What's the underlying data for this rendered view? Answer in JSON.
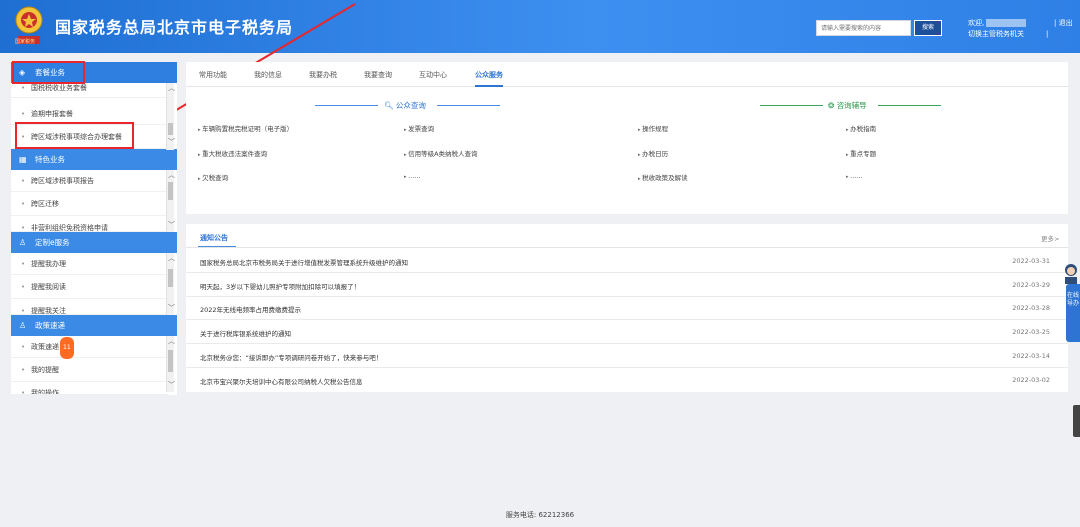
{
  "header": {
    "emblem_caption": "国家税务",
    "title": "国家税务总局北京市电子税务局",
    "search_placeholder": "请输入需要搜索的内容",
    "search_button": "搜索",
    "welcome": "欢迎,",
    "switch_agency": "切换主管税务机关",
    "separator": "|",
    "logout": "| 退出"
  },
  "sidebar": {
    "groups": [
      {
        "label": "套餐业务",
        "items": [
          "国税税收业务套餐",
          "逾期申报套餐",
          "跨区域涉税事项综合办理套餐"
        ]
      },
      {
        "label": "特色业务",
        "items": [
          "跨区域涉税事项报告",
          "跨区迁移",
          "非营利组织免税资格申请"
        ]
      },
      {
        "label": "定制e服务",
        "items": [
          "提醒我办理",
          "提醒我阅读",
          "提醒我关注"
        ]
      },
      {
        "label": "政策速递",
        "items": [
          "政策速递",
          "我的提醒",
          "我的操作"
        ]
      }
    ],
    "policy_badge": "11"
  },
  "tabs": [
    "常用功能",
    "我的信息",
    "我要办税",
    "我要查询",
    "互动中心",
    "公众服务"
  ],
  "active_tab": "公众服务",
  "public_query": {
    "title": "公众查询",
    "links": [
      "车辆购置税完税证明（电子版）",
      "发票查询",
      "重大税收违法案件查询",
      "信用等级A类纳税人查询",
      "欠税查询",
      "......"
    ]
  },
  "consult": {
    "title": "咨询辅导",
    "links": [
      "操作规程",
      "办税指南",
      "办税日历",
      "重点专题",
      "税收政策及解读",
      "......"
    ]
  },
  "notices": {
    "title": "通知公告",
    "more": "更多>",
    "items": [
      {
        "title": "国家税务总局北京市税务局关于进行增值税发票管理系统升级维护的通知",
        "date": "2022-03-31"
      },
      {
        "title": "明天起，3岁以下婴幼儿照护专项附加扣除可以填报了！",
        "date": "2022-03-29"
      },
      {
        "title": "2022年无线电频率占用费缴费提示",
        "date": "2022-03-28"
      },
      {
        "title": "关于进行税库银系统维护的通知",
        "date": "2022-03-25"
      },
      {
        "title": "北京税务@您：“接诉即办”专项调研问卷开始了，快来参与吧！",
        "date": "2022-03-14"
      },
      {
        "title": "北京市宝兴聚尔夫培训中心有限公司纳税人欠税公告信息",
        "date": "2022-03-02"
      }
    ]
  },
  "float_help": "在线导办",
  "footer": "服务电话: 62212366",
  "colors": {
    "header": "#2f80e6",
    "accent": "#2d74d3",
    "green": "#2a9a4e",
    "highlight": "#e8262b"
  }
}
